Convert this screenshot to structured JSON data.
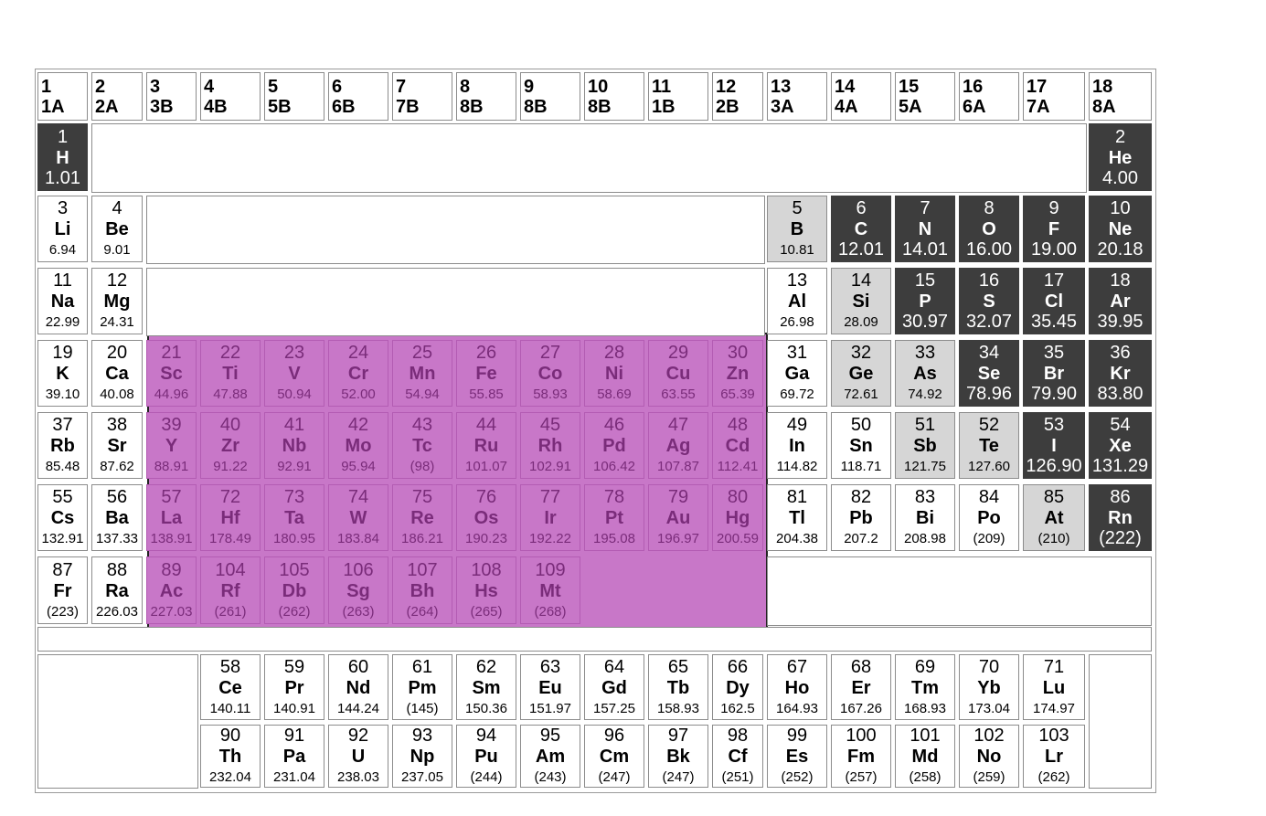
{
  "groups": [
    {
      "n": "1",
      "l": "1A"
    },
    {
      "n": "2",
      "l": "2A"
    },
    {
      "n": "3",
      "l": "3B"
    },
    {
      "n": "4",
      "l": "4B"
    },
    {
      "n": "5",
      "l": "5B"
    },
    {
      "n": "6",
      "l": "6B"
    },
    {
      "n": "7",
      "l": "7B"
    },
    {
      "n": "8",
      "l": "8B"
    },
    {
      "n": "9",
      "l": "8B"
    },
    {
      "n": "10",
      "l": "8B"
    },
    {
      "n": "11",
      "l": "1B"
    },
    {
      "n": "12",
      "l": "2B"
    },
    {
      "n": "13",
      "l": "3A"
    },
    {
      "n": "14",
      "l": "4A"
    },
    {
      "n": "15",
      "l": "5A"
    },
    {
      "n": "16",
      "l": "6A"
    },
    {
      "n": "17",
      "l": "7A"
    },
    {
      "n": "18",
      "l": "8A"
    }
  ],
  "elements": [
    {
      "n": "1",
      "s": "H",
      "m": "1.01",
      "col": 1,
      "row": 1,
      "t": "dark"
    },
    {
      "n": "2",
      "s": "He",
      "m": "4.00",
      "col": 18,
      "row": 1,
      "t": "dark"
    },
    {
      "n": "3",
      "s": "Li",
      "m": "6.94",
      "col": 1,
      "row": 2,
      "t": "plain"
    },
    {
      "n": "4",
      "s": "Be",
      "m": "9.01",
      "col": 2,
      "row": 2,
      "t": "plain"
    },
    {
      "n": "5",
      "s": "B",
      "m": "10.81",
      "col": 13,
      "row": 2,
      "t": "light"
    },
    {
      "n": "6",
      "s": "C",
      "m": "12.01",
      "col": 14,
      "row": 2,
      "t": "dark"
    },
    {
      "n": "7",
      "s": "N",
      "m": "14.01",
      "col": 15,
      "row": 2,
      "t": "dark"
    },
    {
      "n": "8",
      "s": "O",
      "m": "16.00",
      "col": 16,
      "row": 2,
      "t": "dark"
    },
    {
      "n": "9",
      "s": "F",
      "m": "19.00",
      "col": 17,
      "row": 2,
      "t": "dark"
    },
    {
      "n": "10",
      "s": "Ne",
      "m": "20.18",
      "col": 18,
      "row": 2,
      "t": "dark"
    },
    {
      "n": "11",
      "s": "Na",
      "m": "22.99",
      "col": 1,
      "row": 3,
      "t": "plain"
    },
    {
      "n": "12",
      "s": "Mg",
      "m": "24.31",
      "col": 2,
      "row": 3,
      "t": "plain"
    },
    {
      "n": "13",
      "s": "Al",
      "m": "26.98",
      "col": 13,
      "row": 3,
      "t": "plain"
    },
    {
      "n": "14",
      "s": "Si",
      "m": "28.09",
      "col": 14,
      "row": 3,
      "t": "light"
    },
    {
      "n": "15",
      "s": "P",
      "m": "30.97",
      "col": 15,
      "row": 3,
      "t": "dark"
    },
    {
      "n": "16",
      "s": "S",
      "m": "32.07",
      "col": 16,
      "row": 3,
      "t": "dark"
    },
    {
      "n": "17",
      "s": "Cl",
      "m": "35.45",
      "col": 17,
      "row": 3,
      "t": "dark"
    },
    {
      "n": "18",
      "s": "Ar",
      "m": "39.95",
      "col": 18,
      "row": 3,
      "t": "dark"
    },
    {
      "n": "19",
      "s": "K",
      "m": "39.10",
      "col": 1,
      "row": 4,
      "t": "plain"
    },
    {
      "n": "20",
      "s": "Ca",
      "m": "40.08",
      "col": 2,
      "row": 4,
      "t": "plain"
    },
    {
      "n": "21",
      "s": "Sc",
      "m": "44.96",
      "col": 3,
      "row": 4,
      "t": "trans"
    },
    {
      "n": "22",
      "s": "Ti",
      "m": "47.88",
      "col": 4,
      "row": 4,
      "t": "trans"
    },
    {
      "n": "23",
      "s": "V",
      "m": "50.94",
      "col": 5,
      "row": 4,
      "t": "trans"
    },
    {
      "n": "24",
      "s": "Cr",
      "m": "52.00",
      "col": 6,
      "row": 4,
      "t": "trans"
    },
    {
      "n": "25",
      "s": "Mn",
      "m": "54.94",
      "col": 7,
      "row": 4,
      "t": "trans"
    },
    {
      "n": "26",
      "s": "Fe",
      "m": "55.85",
      "col": 8,
      "row": 4,
      "t": "trans"
    },
    {
      "n": "27",
      "s": "Co",
      "m": "58.93",
      "col": 9,
      "row": 4,
      "t": "trans"
    },
    {
      "n": "28",
      "s": "Ni",
      "m": "58.69",
      "col": 10,
      "row": 4,
      "t": "trans"
    },
    {
      "n": "29",
      "s": "Cu",
      "m": "63.55",
      "col": 11,
      "row": 4,
      "t": "trans"
    },
    {
      "n": "30",
      "s": "Zn",
      "m": "65.39",
      "col": 12,
      "row": 4,
      "t": "trans"
    },
    {
      "n": "31",
      "s": "Ga",
      "m": "69.72",
      "col": 13,
      "row": 4,
      "t": "plain"
    },
    {
      "n": "32",
      "s": "Ge",
      "m": "72.61",
      "col": 14,
      "row": 4,
      "t": "light"
    },
    {
      "n": "33",
      "s": "As",
      "m": "74.92",
      "col": 15,
      "row": 4,
      "t": "light"
    },
    {
      "n": "34",
      "s": "Se",
      "m": "78.96",
      "col": 16,
      "row": 4,
      "t": "dark"
    },
    {
      "n": "35",
      "s": "Br",
      "m": "79.90",
      "col": 17,
      "row": 4,
      "t": "dark"
    },
    {
      "n": "36",
      "s": "Kr",
      "m": "83.80",
      "col": 18,
      "row": 4,
      "t": "dark"
    },
    {
      "n": "37",
      "s": "Rb",
      "m": "85.48",
      "col": 1,
      "row": 5,
      "t": "plain"
    },
    {
      "n": "38",
      "s": "Sr",
      "m": "87.62",
      "col": 2,
      "row": 5,
      "t": "plain"
    },
    {
      "n": "39",
      "s": "Y",
      "m": "88.91",
      "col": 3,
      "row": 5,
      "t": "trans"
    },
    {
      "n": "40",
      "s": "Zr",
      "m": "91.22",
      "col": 4,
      "row": 5,
      "t": "trans"
    },
    {
      "n": "41",
      "s": "Nb",
      "m": "92.91",
      "col": 5,
      "row": 5,
      "t": "trans"
    },
    {
      "n": "42",
      "s": "Mo",
      "m": "95.94",
      "col": 6,
      "row": 5,
      "t": "trans"
    },
    {
      "n": "43",
      "s": "Tc",
      "m": "(98)",
      "col": 7,
      "row": 5,
      "t": "trans"
    },
    {
      "n": "44",
      "s": "Ru",
      "m": "101.07",
      "col": 8,
      "row": 5,
      "t": "trans"
    },
    {
      "n": "45",
      "s": "Rh",
      "m": "102.91",
      "col": 9,
      "row": 5,
      "t": "trans"
    },
    {
      "n": "46",
      "s": "Pd",
      "m": "106.42",
      "col": 10,
      "row": 5,
      "t": "trans"
    },
    {
      "n": "47",
      "s": "Ag",
      "m": "107.87",
      "col": 11,
      "row": 5,
      "t": "trans"
    },
    {
      "n": "48",
      "s": "Cd",
      "m": "112.41",
      "col": 12,
      "row": 5,
      "t": "trans"
    },
    {
      "n": "49",
      "s": "In",
      "m": "114.82",
      "col": 13,
      "row": 5,
      "t": "plain"
    },
    {
      "n": "50",
      "s": "Sn",
      "m": "118.71",
      "col": 14,
      "row": 5,
      "t": "plain"
    },
    {
      "n": "51",
      "s": "Sb",
      "m": "121.75",
      "col": 15,
      "row": 5,
      "t": "light"
    },
    {
      "n": "52",
      "s": "Te",
      "m": "127.60",
      "col": 16,
      "row": 5,
      "t": "light"
    },
    {
      "n": "53",
      "s": "I",
      "m": "126.90",
      "col": 17,
      "row": 5,
      "t": "dark"
    },
    {
      "n": "54",
      "s": "Xe",
      "m": "131.29",
      "col": 18,
      "row": 5,
      "t": "dark"
    },
    {
      "n": "55",
      "s": "Cs",
      "m": "132.91",
      "col": 1,
      "row": 6,
      "t": "plain"
    },
    {
      "n": "56",
      "s": "Ba",
      "m": "137.33",
      "col": 2,
      "row": 6,
      "t": "plain"
    },
    {
      "n": "57",
      "s": "La",
      "m": "138.91",
      "col": 3,
      "row": 6,
      "t": "trans"
    },
    {
      "n": "72",
      "s": "Hf",
      "m": "178.49",
      "col": 4,
      "row": 6,
      "t": "trans"
    },
    {
      "n": "73",
      "s": "Ta",
      "m": "180.95",
      "col": 5,
      "row": 6,
      "t": "trans"
    },
    {
      "n": "74",
      "s": "W",
      "m": "183.84",
      "col": 6,
      "row": 6,
      "t": "trans"
    },
    {
      "n": "75",
      "s": "Re",
      "m": "186.21",
      "col": 7,
      "row": 6,
      "t": "trans"
    },
    {
      "n": "76",
      "s": "Os",
      "m": "190.23",
      "col": 8,
      "row": 6,
      "t": "trans"
    },
    {
      "n": "77",
      "s": "Ir",
      "m": "192.22",
      "col": 9,
      "row": 6,
      "t": "trans"
    },
    {
      "n": "78",
      "s": "Pt",
      "m": "195.08",
      "col": 10,
      "row": 6,
      "t": "trans"
    },
    {
      "n": "79",
      "s": "Au",
      "m": "196.97",
      "col": 11,
      "row": 6,
      "t": "trans"
    },
    {
      "n": "80",
      "s": "Hg",
      "m": "200.59",
      "col": 12,
      "row": 6,
      "t": "trans"
    },
    {
      "n": "81",
      "s": "Tl",
      "m": "204.38",
      "col": 13,
      "row": 6,
      "t": "plain"
    },
    {
      "n": "82",
      "s": "Pb",
      "m": "207.2",
      "col": 14,
      "row": 6,
      "t": "plain"
    },
    {
      "n": "83",
      "s": "Bi",
      "m": "208.98",
      "col": 15,
      "row": 6,
      "t": "plain"
    },
    {
      "n": "84",
      "s": "Po",
      "m": "(209)",
      "col": 16,
      "row": 6,
      "t": "plain"
    },
    {
      "n": "85",
      "s": "At",
      "m": "(210)",
      "col": 17,
      "row": 6,
      "t": "light"
    },
    {
      "n": "86",
      "s": "Rn",
      "m": "(222)",
      "col": 18,
      "row": 6,
      "t": "dark"
    },
    {
      "n": "87",
      "s": "Fr",
      "m": "(223)",
      "col": 1,
      "row": 7,
      "t": "plain"
    },
    {
      "n": "88",
      "s": "Ra",
      "m": "226.03",
      "col": 2,
      "row": 7,
      "t": "plain"
    },
    {
      "n": "89",
      "s": "Ac",
      "m": "227.03",
      "col": 3,
      "row": 7,
      "t": "trans"
    },
    {
      "n": "104",
      "s": "Rf",
      "m": "(261)",
      "col": 4,
      "row": 7,
      "t": "trans"
    },
    {
      "n": "105",
      "s": "Db",
      "m": "(262)",
      "col": 5,
      "row": 7,
      "t": "trans"
    },
    {
      "n": "106",
      "s": "Sg",
      "m": "(263)",
      "col": 6,
      "row": 7,
      "t": "trans"
    },
    {
      "n": "107",
      "s": "Bh",
      "m": "(264)",
      "col": 7,
      "row": 7,
      "t": "trans"
    },
    {
      "n": "108",
      "s": "Hs",
      "m": "(265)",
      "col": 8,
      "row": 7,
      "t": "trans"
    },
    {
      "n": "109",
      "s": "Mt",
      "m": "(268)",
      "col": 9,
      "row": 7,
      "t": "trans"
    },
    {
      "n": "58",
      "s": "Ce",
      "m": "140.11",
      "col": 4,
      "row": 8,
      "t": "plain"
    },
    {
      "n": "59",
      "s": "Pr",
      "m": "140.91",
      "col": 5,
      "row": 8,
      "t": "plain"
    },
    {
      "n": "60",
      "s": "Nd",
      "m": "144.24",
      "col": 6,
      "row": 8,
      "t": "plain"
    },
    {
      "n": "61",
      "s": "Pm",
      "m": "(145)",
      "col": 7,
      "row": 8,
      "t": "plain"
    },
    {
      "n": "62",
      "s": "Sm",
      "m": "150.36",
      "col": 8,
      "row": 8,
      "t": "plain"
    },
    {
      "n": "63",
      "s": "Eu",
      "m": "151.97",
      "col": 9,
      "row": 8,
      "t": "plain"
    },
    {
      "n": "64",
      "s": "Gd",
      "m": "157.25",
      "col": 10,
      "row": 8,
      "t": "plain"
    },
    {
      "n": "65",
      "s": "Tb",
      "m": "158.93",
      "col": 11,
      "row": 8,
      "t": "plain"
    },
    {
      "n": "66",
      "s": "Dy",
      "m": "162.5",
      "col": 12,
      "row": 8,
      "t": "plain"
    },
    {
      "n": "67",
      "s": "Ho",
      "m": "164.93",
      "col": 13,
      "row": 8,
      "t": "plain"
    },
    {
      "n": "68",
      "s": "Er",
      "m": "167.26",
      "col": 14,
      "row": 8,
      "t": "plain"
    },
    {
      "n": "69",
      "s": "Tm",
      "m": "168.93",
      "col": 15,
      "row": 8,
      "t": "plain"
    },
    {
      "n": "70",
      "s": "Yb",
      "m": "173.04",
      "col": 16,
      "row": 8,
      "t": "plain"
    },
    {
      "n": "71",
      "s": "Lu",
      "m": "174.97",
      "col": 17,
      "row": 8,
      "t": "plain"
    },
    {
      "n": "90",
      "s": "Th",
      "m": "232.04",
      "col": 4,
      "row": 9,
      "t": "plain"
    },
    {
      "n": "91",
      "s": "Pa",
      "m": "231.04",
      "col": 5,
      "row": 9,
      "t": "plain"
    },
    {
      "n": "92",
      "s": "U",
      "m": "238.03",
      "col": 6,
      "row": 9,
      "t": "plain"
    },
    {
      "n": "93",
      "s": "Np",
      "m": "237.05",
      "col": 7,
      "row": 9,
      "t": "plain"
    },
    {
      "n": "94",
      "s": "Pu",
      "m": "(244)",
      "col": 8,
      "row": 9,
      "t": "plain"
    },
    {
      "n": "95",
      "s": "Am",
      "m": "(243)",
      "col": 9,
      "row": 9,
      "t": "plain"
    },
    {
      "n": "96",
      "s": "Cm",
      "m": "(247)",
      "col": 10,
      "row": 9,
      "t": "plain"
    },
    {
      "n": "97",
      "s": "Bk",
      "m": "(247)",
      "col": 11,
      "row": 9,
      "t": "plain"
    },
    {
      "n": "98",
      "s": "Cf",
      "m": "(251)",
      "col": 12,
      "row": 9,
      "t": "plain"
    },
    {
      "n": "99",
      "s": "Es",
      "m": "(252)",
      "col": 13,
      "row": 9,
      "t": "plain"
    },
    {
      "n": "100",
      "s": "Fm",
      "m": "(257)",
      "col": 14,
      "row": 9,
      "t": "plain"
    },
    {
      "n": "101",
      "s": "Md",
      "m": "(258)",
      "col": 15,
      "row": 9,
      "t": "plain"
    },
    {
      "n": "102",
      "s": "No",
      "m": "(259)",
      "col": 16,
      "row": 9,
      "t": "plain"
    },
    {
      "n": "103",
      "s": "Lr",
      "m": "(262)",
      "col": 17,
      "row": 9,
      "t": "plain"
    }
  ],
  "colors": {
    "dark_fill": "#3d3d3d",
    "light_fill": "#d6d6d6",
    "transition_fill": "#c877c8",
    "transition_text": "#7a2c7a"
  }
}
